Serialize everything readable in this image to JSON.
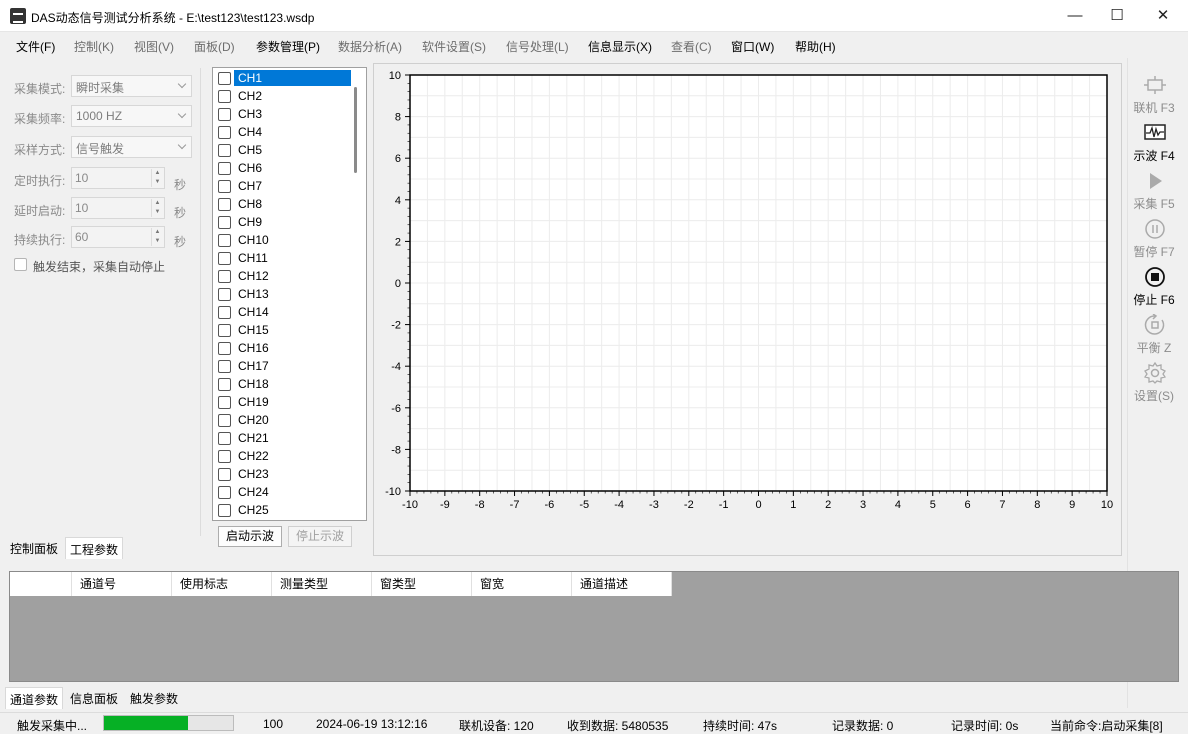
{
  "window": {
    "title": "DAS动态信号测试分析系统 - E:\\test123\\test123.wsdp",
    "minimize": "—",
    "maximize": "☐",
    "close": "✕"
  },
  "menu": [
    {
      "label": "文件(F)",
      "enabled": true
    },
    {
      "label": "控制(K)",
      "enabled": false
    },
    {
      "label": "视图(V)",
      "enabled": false
    },
    {
      "label": "面板(D)",
      "enabled": false
    },
    {
      "label": "参数管理(P)",
      "enabled": true
    },
    {
      "label": "数据分析(A)",
      "enabled": false
    },
    {
      "label": "软件设置(S)",
      "enabled": false
    },
    {
      "label": "信号处理(L)",
      "enabled": false
    },
    {
      "label": "信息显示(X)",
      "enabled": true
    },
    {
      "label": "查看(C)",
      "enabled": false
    },
    {
      "label": "窗口(W)",
      "enabled": true
    },
    {
      "label": "帮助(H)",
      "enabled": true
    }
  ],
  "control": {
    "mode_label": "采集模式:",
    "mode_value": "瞬时采集",
    "freq_label": "采集频率:",
    "freq_value": "1000 HZ",
    "sample_label": "采样方式:",
    "sample_value": "信号触发",
    "timed_label": "定时执行:",
    "timed_value": "10",
    "delay_label": "延时启动:",
    "delay_value": "10",
    "duration_label": "持续执行:",
    "duration_value": "60",
    "unit": "秒",
    "auto_stop_label": "触发结束，采集自动停止"
  },
  "left_tabs": [
    "控制面板",
    "工程参数"
  ],
  "channels": [
    "CH1",
    "CH2",
    "CH3",
    "CH4",
    "CH5",
    "CH6",
    "CH7",
    "CH8",
    "CH9",
    "CH10",
    "CH11",
    "CH12",
    "CH13",
    "CH14",
    "CH15",
    "CH16",
    "CH17",
    "CH18",
    "CH19",
    "CH20",
    "CH21",
    "CH22",
    "CH23",
    "CH24",
    "CH25"
  ],
  "selected_channel": "CH1",
  "buttons": {
    "start_wave": "启动示波",
    "stop_wave": "停止示波"
  },
  "chart_data": {
    "type": "line",
    "series": [],
    "xlim": [
      -10,
      10
    ],
    "ylim": [
      -10,
      10
    ],
    "x_ticks": [
      -10,
      -9,
      -8,
      -7,
      -6,
      -5,
      -4,
      -3,
      -2,
      -1,
      0,
      1,
      2,
      3,
      4,
      5,
      6,
      7,
      8,
      9,
      10
    ],
    "y_ticks": [
      10,
      8,
      6,
      4,
      2,
      0,
      -2,
      -4,
      -6,
      -8,
      -10
    ],
    "grid": true,
    "title": "",
    "xlabel": "",
    "ylabel": ""
  },
  "toolbar": [
    {
      "name": "connect",
      "label": "联机 F3",
      "enabled": false
    },
    {
      "name": "wave",
      "label": "示波 F4",
      "enabled": true
    },
    {
      "name": "collect",
      "label": "采集 F5",
      "enabled": false
    },
    {
      "name": "pause",
      "label": "暂停 F7",
      "enabled": false
    },
    {
      "name": "stop",
      "label": "停止 F6",
      "enabled": true
    },
    {
      "name": "balance",
      "label": "平衡 Z",
      "enabled": false
    },
    {
      "name": "settings",
      "label": "设置(S)",
      "enabled": false
    }
  ],
  "table": {
    "columns": [
      "",
      "通道号",
      "使用标志",
      "测量类型",
      "窗类型",
      "窗宽",
      "通道描述"
    ]
  },
  "bottom_tabs": [
    "通道参数",
    "信息面板",
    "触发参数"
  ],
  "status": {
    "state": "触发采集中...",
    "progress_fraction": 0.65,
    "progress_value": "100",
    "datetime": "2024-06-19 13:12:16",
    "devices": "联机设备: 120",
    "received": "收到数据: 5480535",
    "duration": "持续时间: 47s",
    "records": "记录数据: 0",
    "record_time": "记录时间: 0s",
    "command": "当前命令:启动采集[8]"
  },
  "colors": {
    "selection": "#0078d7",
    "progress": "#06b025",
    "grid": "#e6e6e6"
  }
}
